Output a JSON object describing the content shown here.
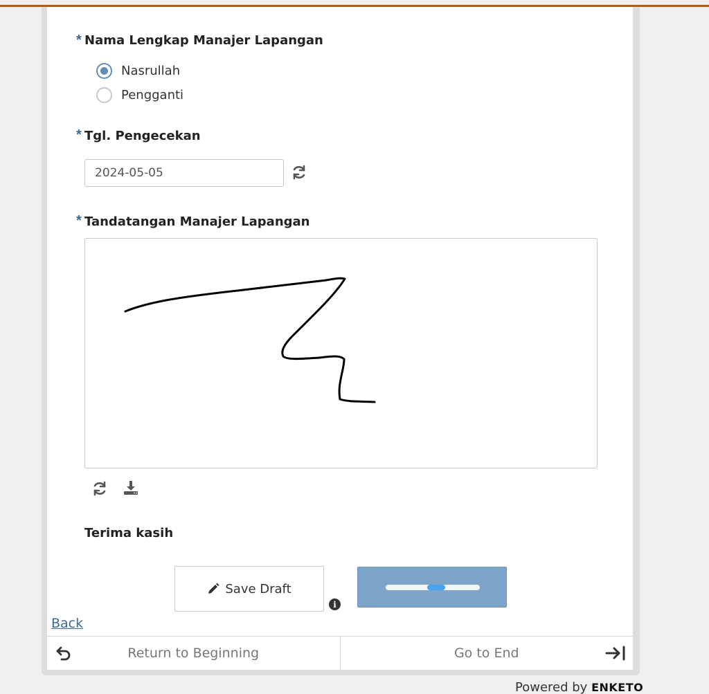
{
  "form": {
    "q1": {
      "label": "Nama Lengkap Manajer Lapangan",
      "required_mark": "*",
      "options": [
        "Nasrullah",
        "Pengganti"
      ],
      "selected": "Nasrullah"
    },
    "q2": {
      "label": "Tgl. Pengecekan",
      "required_mark": "*",
      "value": "2024-05-05"
    },
    "q3": {
      "label": "Tandatangan Manajer Lapangan",
      "required_mark": "*"
    },
    "note": "Terima kasih"
  },
  "actions": {
    "save_draft": "Save Draft",
    "back": "Back"
  },
  "nav": {
    "return": "Return to Beginning",
    "end": "Go to End"
  },
  "footer": {
    "powered_by": "Powered by",
    "brand": "ENKETO"
  },
  "colors": {
    "accent": "#3c6a96",
    "topbar": "#b35a10",
    "submit": "#7da4c8"
  },
  "icons": [
    "refresh-icon",
    "download-icon",
    "pencil-icon",
    "info-icon",
    "undo-icon",
    "arrow-to-end-icon"
  ]
}
